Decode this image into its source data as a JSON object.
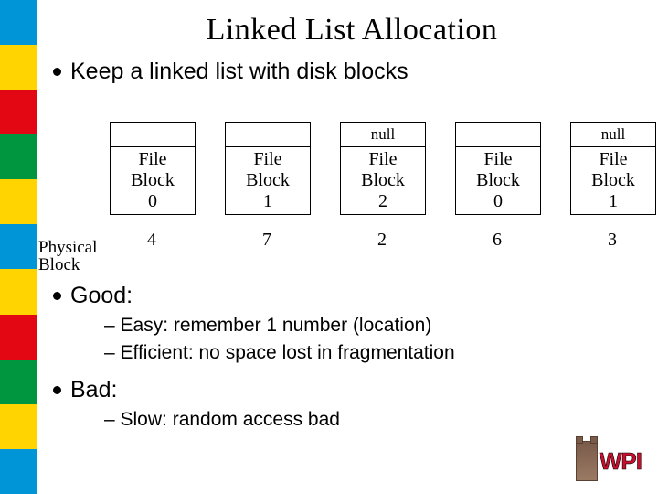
{
  "title": "Linked List Allocation",
  "bullets": {
    "keep": "Keep a linked list with disk blocks",
    "good": "Good:",
    "good_sub1": "– Easy: remember 1 number (location)",
    "good_sub2": "– Efficient: no space lost in fragmentation",
    "bad": "Bad:",
    "bad_sub1": "– Slow: random access bad"
  },
  "blocks": [
    {
      "ptr": "",
      "label": "File\nBlock\n0",
      "phys": "4"
    },
    {
      "ptr": "",
      "label": "File\nBlock\n1",
      "phys": "7"
    },
    {
      "ptr": "null",
      "label": "File\nBlock\n2",
      "phys": "2"
    },
    {
      "ptr": "",
      "label": "File\nBlock\n0",
      "phys": "6"
    },
    {
      "ptr": "null",
      "label": "File\nBlock\n1",
      "phys": "3"
    }
  ],
  "phys_label": "Physical\nBlock",
  "logo_text": "WPI",
  "stripe_colors": [
    "#0095d6",
    "#ffd400",
    "#e30613",
    "#009640",
    "#ffd400",
    "#0095d6",
    "#ffd400",
    "#e30613",
    "#009640",
    "#ffd400",
    "#0095d6"
  ]
}
